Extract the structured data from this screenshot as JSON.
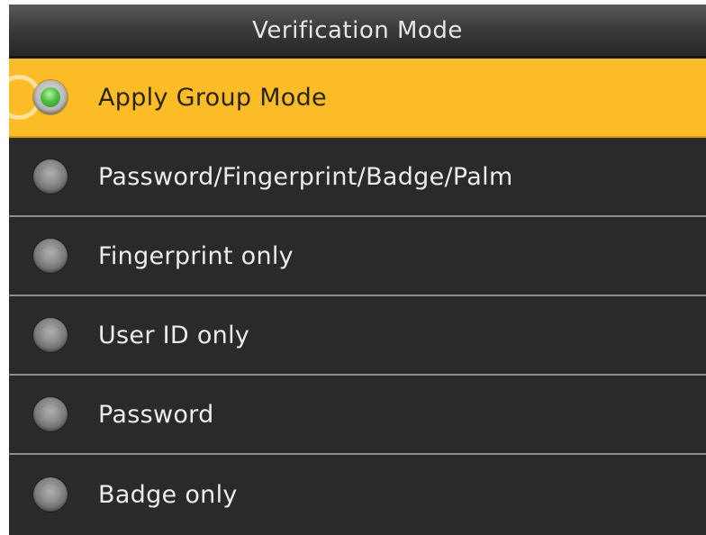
{
  "header": {
    "title": "Verification Mode"
  },
  "options": [
    {
      "label": "Apply Group Mode",
      "selected": true
    },
    {
      "label": "Password/Fingerprint/Badge/Palm",
      "selected": false
    },
    {
      "label": "Fingerprint only",
      "selected": false
    },
    {
      "label": "User ID only",
      "selected": false
    },
    {
      "label": "Password",
      "selected": false
    },
    {
      "label": "Badge only",
      "selected": false
    }
  ],
  "colors": {
    "highlight": "#fbbc27",
    "background": "#2a2a2a",
    "radio_selected": "#4fc043",
    "radio_unselected": "#8a8a8a"
  }
}
